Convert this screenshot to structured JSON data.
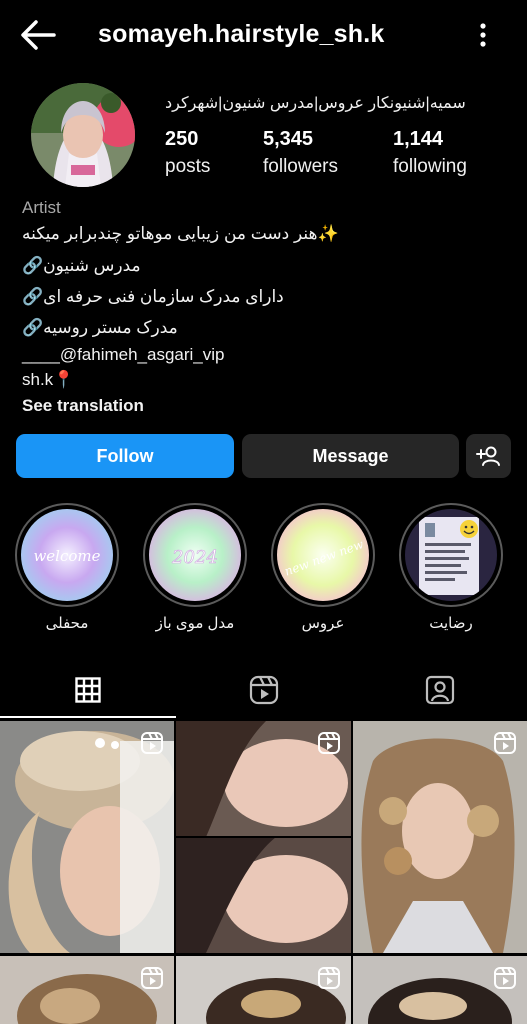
{
  "header": {
    "username": "somayeh.hairstyle_sh.k",
    "back_icon": "arrow-left-icon",
    "more_icon": "more-vertical-icon"
  },
  "profile": {
    "display_name": "سمیه|شنیونکار عروس|مدرس شنیون|شهرکرد",
    "stats": {
      "posts": {
        "value": "250",
        "label": "posts"
      },
      "followers": {
        "value": "5,345",
        "label": "followers"
      },
      "following": {
        "value": "1,144",
        "label": "following"
      }
    }
  },
  "bio": {
    "category": "Artist",
    "lines": [
      "✨هنر دست من زیبایی موهاتو چندبرابر میکنه",
      "مدرس شنیون🔗",
      "دارای مدرک سازمان فنی حرفه ای🔗",
      "مدرک مستر روسیه🔗",
      "____@fahimeh_asgari_vip",
      "sh.k📍"
    ],
    "see_translation": "See translation"
  },
  "actions": {
    "follow": "Follow",
    "message": "Message",
    "add_user_icon": "add-person-icon"
  },
  "highlights": [
    {
      "label": "محفلی",
      "cover_text": "welcome"
    },
    {
      "label": "مدل موی باز",
      "cover_text": "2024"
    },
    {
      "label": "عروس",
      "cover_text": "new new new"
    },
    {
      "label": "رضایت",
      "cover_text": ""
    }
  ],
  "tabs": [
    "grid-icon",
    "reels-icon",
    "tagged-icon"
  ],
  "colors": {
    "background": "#000000",
    "follow_button": "#1a95f6",
    "secondary_button": "#262626",
    "muted_text": "#a8a8a8"
  }
}
